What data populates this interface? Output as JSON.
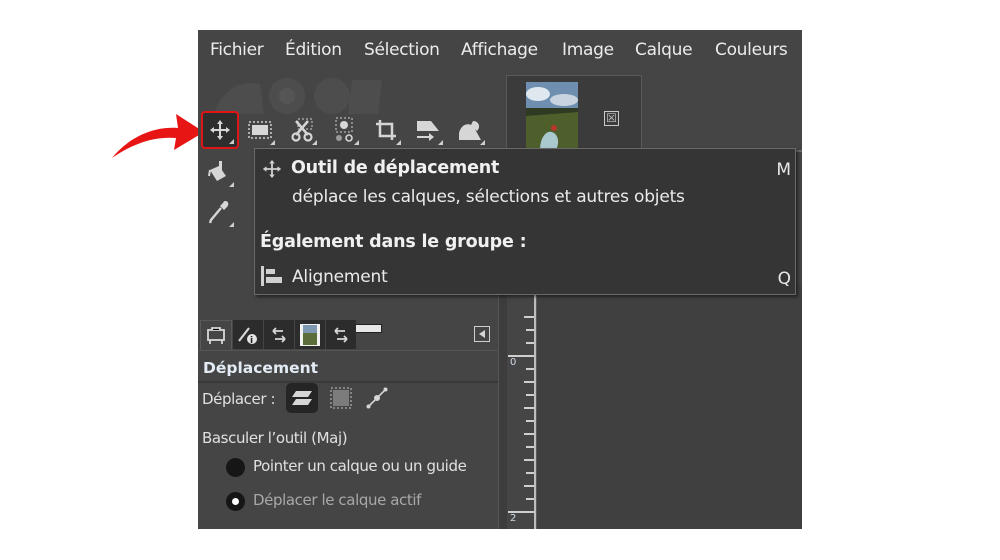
{
  "menubar": {
    "items": [
      {
        "label": "Fichier"
      },
      {
        "label": "Édition"
      },
      {
        "label": "Sélection"
      },
      {
        "label": "Affichage"
      },
      {
        "label": "Image"
      },
      {
        "label": "Calque"
      },
      {
        "label": "Couleurs"
      }
    ]
  },
  "toolbox": {
    "tools": [
      {
        "name": "move-tool",
        "icon": "move-icon",
        "active": true
      },
      {
        "name": "rect-select-tool",
        "icon": "rect-select-icon"
      },
      {
        "name": "scissors-select-tool",
        "icon": "scissors-icon"
      },
      {
        "name": "foreground-select-tool",
        "icon": "foreground-select-icon"
      },
      {
        "name": "crop-tool",
        "icon": "crop-icon"
      },
      {
        "name": "transform-tool",
        "icon": "transform-icon"
      },
      {
        "name": "warp-tool",
        "icon": "warp-icon"
      },
      {
        "name": "bucket-fill-tool",
        "icon": "bucket-fill-icon"
      },
      {
        "name": "color-picker-tool",
        "icon": "eyedropper-icon"
      }
    ],
    "highlight_color": "#e01515"
  },
  "images_panel": {
    "close_glyph": "☒"
  },
  "tooltip": {
    "title": "Outil de déplacement",
    "shortcut": "M",
    "description": "déplace les calques, sélections et autres objets",
    "group_heading": "Également dans le groupe :",
    "group_items": [
      {
        "label": "Alignement",
        "shortcut": "Q",
        "icon": "align-icon"
      }
    ]
  },
  "dock_tabs": [
    {
      "name": "tool-options-tab",
      "icon": "tool-options-icon",
      "selected": true
    },
    {
      "name": "device-status-tab",
      "icon": "device-status-icon"
    },
    {
      "name": "undo-history-tab",
      "icon": "undo-icon"
    },
    {
      "name": "images-tab",
      "icon": "image-thumbnail-icon"
    },
    {
      "name": "undo-history-tab-2",
      "icon": "undo-icon"
    }
  ],
  "tool_options": {
    "title": "Déplacement",
    "move_label": "Déplacer :",
    "move_modes": [
      {
        "name": "layer",
        "icon": "layer-icon",
        "selected": true
      },
      {
        "name": "selection",
        "icon": "selection-icon"
      },
      {
        "name": "path",
        "icon": "path-icon"
      }
    ],
    "toggle_label": "Basculer l’outil (Maj)",
    "radio_options": [
      {
        "label": "Pointer un calque ou un guide",
        "checked": false
      },
      {
        "label": "Déplacer le calque actif",
        "checked": true
      }
    ]
  },
  "ruler": {
    "labels": [
      "0",
      "2"
    ]
  },
  "annotation": {
    "arrow_color": "#e81515"
  }
}
